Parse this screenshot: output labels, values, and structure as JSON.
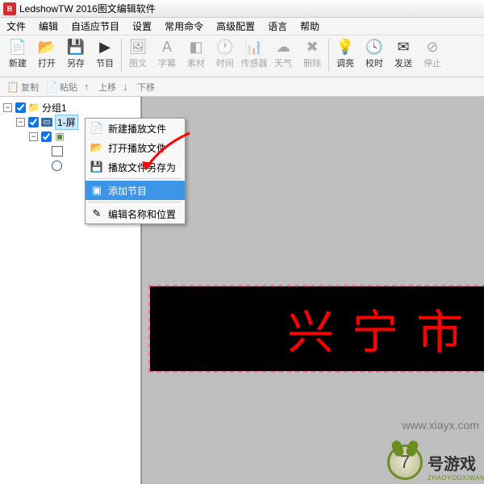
{
  "title": "LedshowTW 2016图文编辑软件",
  "menu": [
    "文件",
    "编辑",
    "自适应节目",
    "设置",
    "常用命令",
    "高级配置",
    "语言",
    "帮助"
  ],
  "tools": [
    {
      "label": "新建",
      "icon": "📄",
      "enabled": true
    },
    {
      "label": "打开",
      "icon": "📂",
      "enabled": true
    },
    {
      "label": "另存",
      "icon": "💾",
      "enabled": true
    },
    {
      "label": "节目",
      "icon": "▶",
      "enabled": true
    },
    {
      "label": "图文",
      "icon": "🖼",
      "enabled": false
    },
    {
      "label": "字幕",
      "icon": "A",
      "enabled": false
    },
    {
      "label": "素材",
      "icon": "◧",
      "enabled": false
    },
    {
      "label": "时间",
      "icon": "🕐",
      "enabled": false
    },
    {
      "label": "传感器",
      "icon": "📊",
      "enabled": false
    },
    {
      "label": "天气",
      "icon": "☁",
      "enabled": false
    },
    {
      "label": "删除",
      "icon": "✖",
      "enabled": false
    },
    {
      "label": "调亮",
      "icon": "💡",
      "enabled": true
    },
    {
      "label": "校时",
      "icon": "🕓",
      "enabled": true
    },
    {
      "label": "发送",
      "icon": "✉",
      "enabled": true
    },
    {
      "label": "停止",
      "icon": "⊘",
      "enabled": false
    }
  ],
  "subtools": [
    {
      "label": "复制",
      "icon": "📋"
    },
    {
      "label": "粘贴",
      "icon": "📄"
    },
    {
      "label": "上移",
      "icon": "↑"
    },
    {
      "label": "下移",
      "icon": "↓"
    }
  ],
  "tree": {
    "root": "分组1",
    "screen": "1-屏"
  },
  "ctx": {
    "items": [
      {
        "label": "新建播放文件",
        "icon": "📄"
      },
      {
        "label": "打开播放文件",
        "icon": "📂"
      },
      {
        "label": "播放文件另存为",
        "icon": "💾"
      }
    ],
    "highlighted": {
      "label": "添加节目",
      "icon": "▣"
    },
    "last": {
      "label": "编辑名称和位置",
      "icon": "✎"
    }
  },
  "led_text": "兴宁市",
  "watermark1": "www.xiayx.com",
  "watermark2": {
    "main": "号游戏",
    "num": "7",
    "sub": "ZHAOYOUXIWANG"
  }
}
